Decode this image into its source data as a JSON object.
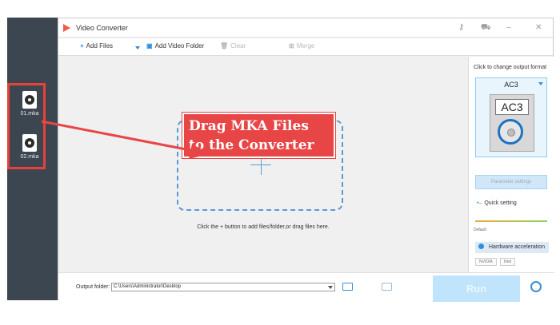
{
  "desktop": {
    "files": [
      {
        "name": "01.mka"
      },
      {
        "name": "02.mka"
      }
    ]
  },
  "window": {
    "title": "Video Converter"
  },
  "toolbar": {
    "add_files": "Add Files",
    "add_video_folder": "Add Video Folder",
    "clear": "Clear",
    "merge": "Merge"
  },
  "main": {
    "drop_hint": "Click the + button to add files/folder,or drag files here."
  },
  "callout": {
    "line1": "Drag MKA Files",
    "line2": "to the Converter"
  },
  "right_panel": {
    "heading": "Click to change output format",
    "format": "AC3",
    "format_icon_label": "AC3",
    "parameter_settings": "Parameter settings",
    "quick_setting": "Quick setting",
    "slider_label": "Default",
    "hardware_acceleration": "Hardware acceleration",
    "vendors": [
      "NVIDIA",
      "Intel"
    ]
  },
  "bottom": {
    "output_folder_label": "Output folder:",
    "output_folder_value": "C:\\Users\\Administrator\\Desktop",
    "run": "Run"
  },
  "colors": {
    "accent": "#3a8fd6",
    "callout": "#e84646",
    "desktop": "#3c4650",
    "run_button": "#bfe4fb"
  }
}
